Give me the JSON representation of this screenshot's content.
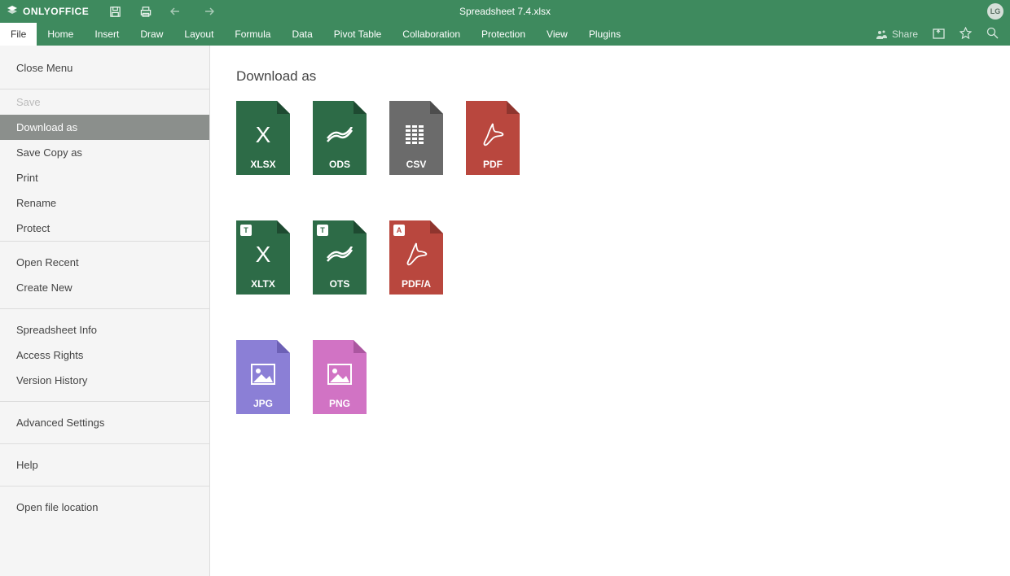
{
  "app": {
    "brand": "ONLYOFFICE",
    "doc_title": "Spreadsheet 7.4.xlsx",
    "avatar_initials": "LG"
  },
  "tabs": {
    "file": "File",
    "home": "Home",
    "insert": "Insert",
    "draw": "Draw",
    "layout": "Layout",
    "formula": "Formula",
    "data": "Data",
    "pivot": "Pivot Table",
    "collab": "Collaboration",
    "protect": "Protection",
    "view": "View",
    "plugins": "Plugins"
  },
  "menuright": {
    "share": "Share"
  },
  "sidebar": {
    "close": "Close Menu",
    "save": "Save",
    "download": "Download as",
    "savecopy": "Save Copy as",
    "print": "Print",
    "rename": "Rename",
    "protect": "Protect",
    "openrecent": "Open Recent",
    "createnew": "Create New",
    "info": "Spreadsheet Info",
    "access": "Access Rights",
    "version": "Version History",
    "advanced": "Advanced Settings",
    "help": "Help",
    "openloc": "Open file location"
  },
  "content": {
    "heading": "Download as",
    "formats": {
      "xlsx": "XLSX",
      "ods": "ODS",
      "csv": "CSV",
      "pdf": "PDF",
      "xltx": "XLTX",
      "ots": "OTS",
      "pdfa": "PDF/A",
      "jpg": "JPG",
      "png": "PNG"
    },
    "badges": {
      "t": "T",
      "a": "A"
    }
  }
}
